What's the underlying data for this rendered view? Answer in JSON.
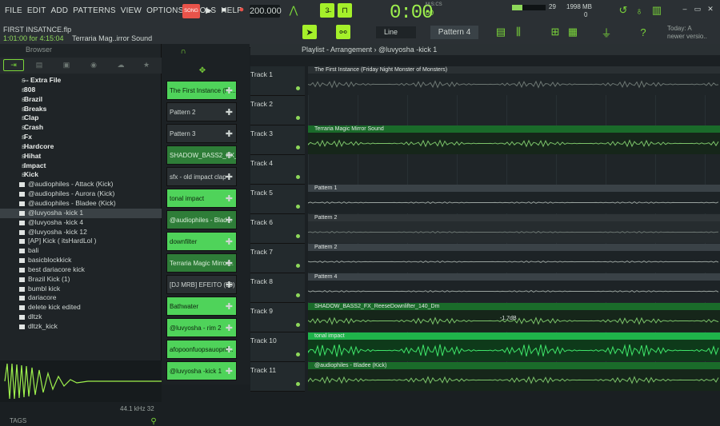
{
  "menu": [
    "FILE",
    "EDIT",
    "ADD",
    "PATTERNS",
    "VIEW",
    "OPTIONS",
    "TOOLS",
    "HELP"
  ],
  "hint": {
    "project": "FIRST INSATNCE.flp",
    "time": "1:01:00 for 4:15:04",
    "status": "Terraria Mag..irror Sound"
  },
  "transport": {
    "mode": "SONG",
    "tempo": "200.000",
    "time": "0:00",
    "time_sub": "00",
    "msc": "M:S:CS"
  },
  "meters": {
    "cpu": "29",
    "mem": "1998 MB",
    "mem_sub": "0"
  },
  "snap": "Line",
  "pattern": "Pattern 4",
  "news": {
    "line1": "Today: A",
    "line2": "newer versio.."
  },
  "browser": {
    "title": "Browser",
    "folders": [
      "-- Extra File",
      "808",
      "Brazil",
      "Breaks",
      "Clap",
      "Crash",
      "Fx",
      "Hardcore",
      "Hihat",
      "Impact",
      "Kick"
    ],
    "files": [
      "@audiophiles - Attack (Kick)",
      "@audiophiles - Aurora (Kick)",
      "@audiophiles - Bladee (Kick)",
      "@luvyosha -kick 1",
      "@luvyosha -kick 4",
      "@luvyosha -kick 12",
      "[AP] Kick ( itsHardLol )",
      "bali",
      "basicblockkick",
      "best dariacore kick",
      "Brazil Kick (1)",
      "bumbl kick",
      "dariacore",
      "delete kick edited",
      "dltzk",
      "dltzk_kick"
    ],
    "selected_index": 3,
    "rate": "44.1 kHz 32",
    "tags": "TAGS"
  },
  "channels": [
    {
      "label": "The First Instance (Fr...",
      "style": "bright"
    },
    {
      "label": "Pattern 2",
      "style": "dark"
    },
    {
      "label": "Pattern 3",
      "style": "dark"
    },
    {
      "label": "SHADOW_BASS2_FX_...",
      "style": "mid"
    },
    {
      "label": "sfx - old impact clap",
      "style": "dark"
    },
    {
      "label": "tonal impact",
      "style": "bright"
    },
    {
      "label": "@audiophiles - Blad...",
      "style": "mid"
    },
    {
      "label": "downfilter",
      "style": "bright"
    },
    {
      "label": "Terraria Magic Mirror...",
      "style": "mid"
    },
    {
      "label": "[DJ MRB] EFEITO (50)",
      "style": "dark"
    },
    {
      "label": "Bathwater",
      "style": "bright"
    },
    {
      "label": "@luvyosha - rim 2",
      "style": "bright"
    },
    {
      "label": "afopoonfuopsauopnf...",
      "style": "bright"
    },
    {
      "label": "@luvyosha -kick 1",
      "style": "bright"
    }
  ],
  "playlist": {
    "title": "Playlist - Arrangement",
    "breadcrumb": "@luvyosha -kick 1",
    "tracks": [
      "Track 1",
      "Track 2",
      "Track 3",
      "Track 4",
      "Track 5",
      "Track 6",
      "Track 7",
      "Track 8",
      "Track 9",
      "Track 10",
      "Track 11"
    ],
    "clips": [
      {
        "track": 0,
        "label": "The First Instance (Friday Night Monster of Monsters)",
        "kind": "audio-dark"
      },
      {
        "track": 2,
        "label": "Terraria Magic Mirror Sound",
        "kind": "audio-green"
      },
      {
        "track": 4,
        "label": "Pattern 1",
        "kind": "pattern"
      },
      {
        "track": 5,
        "label": "Pattern 2",
        "kind": "pattern-muted"
      },
      {
        "track": 6,
        "label": "Pattern 2",
        "kind": "pattern"
      },
      {
        "track": 7,
        "label": "Pattern 4",
        "kind": "pattern"
      },
      {
        "track": 8,
        "label": "SHADOW_BASS2_FX_ReeseDownlifter_140_Dm",
        "kind": "audio-green"
      },
      {
        "track": 9,
        "label": "tonal impact",
        "kind": "audio-bright"
      },
      {
        "track": 10,
        "label": "@audiophiles - Bladee (Kick)",
        "kind": "audio-green"
      }
    ],
    "gain_label": "-1.7dB"
  },
  "colors": {
    "accent": "#9ef14d",
    "bright": "#4fd35a",
    "mid": "#2e7d38",
    "dark": "#2a3033"
  }
}
